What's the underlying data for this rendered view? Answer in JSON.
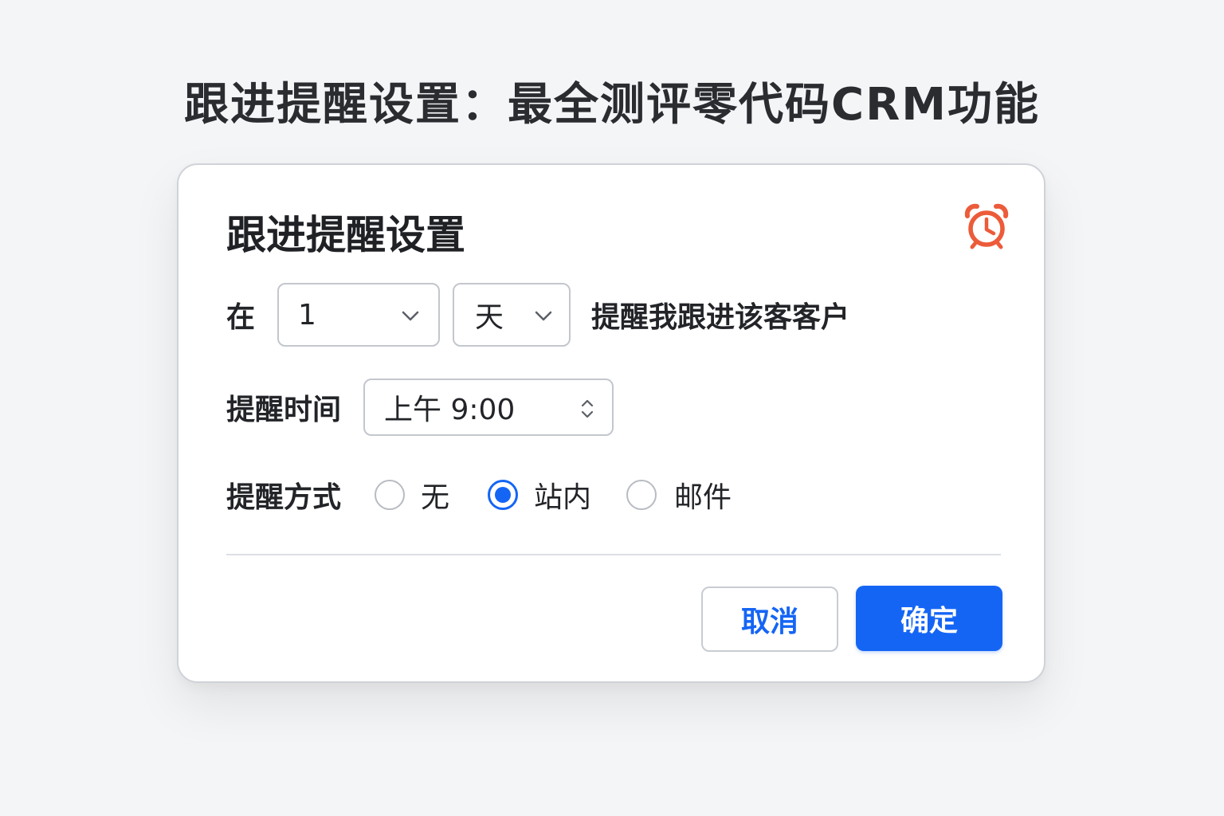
{
  "page": {
    "heading": "跟进提醒设置：最全测评零代码CRM功能"
  },
  "dialog": {
    "title": "跟进提醒设置",
    "icon": "alarm-clock-icon",
    "accent_color": "#1565f5",
    "icon_color": "#ec5b3a",
    "schedule_row": {
      "prefix": "在",
      "amount_value": "1",
      "unit_value": "天",
      "suffix": "提醒我跟进该客客户"
    },
    "time_row": {
      "label": "提醒时间",
      "value": "上午 9:00"
    },
    "method_row": {
      "label": "提醒方式",
      "options": [
        {
          "label": "无",
          "checked": false
        },
        {
          "label": "站内",
          "checked": true
        },
        {
          "label": "邮件",
          "checked": false
        }
      ]
    },
    "buttons": {
      "cancel": "取消",
      "ok": "确定"
    }
  }
}
